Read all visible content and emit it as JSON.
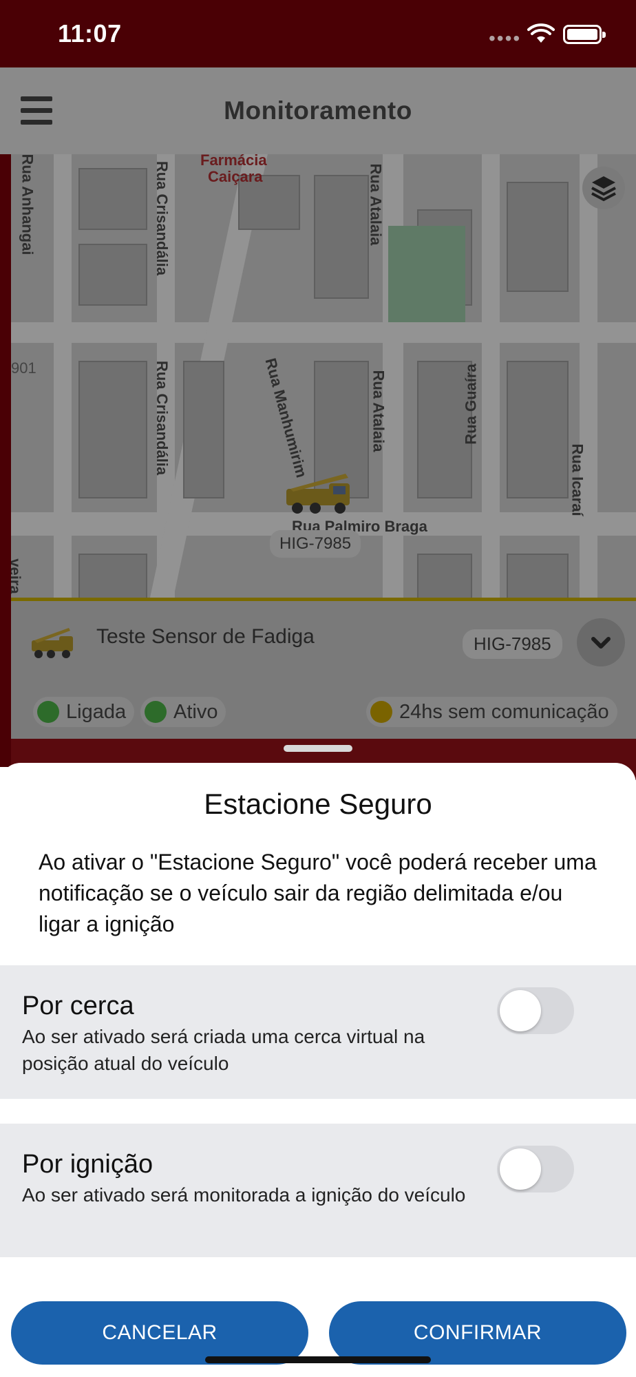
{
  "status": {
    "time": "11:07"
  },
  "header": {
    "title": "Monitoramento"
  },
  "map": {
    "labels": {
      "pharmacy_line1": "Farmácia",
      "pharmacy_line2": "Caiçara",
      "rua_anhangai": "Rua Anhangai",
      "rua_crisandalia_top": "Rua Crisandália",
      "rua_crisandalia_bottom": "Rua Crisandália",
      "rua_atalaia_top": "Rua Atalaia",
      "rua_atalaia_bottom": "Rua Atalaia",
      "rua_manhumirim": "Rua Manhumirim",
      "rua_guaira": "Rua Guaíra",
      "rua_icarai": "Rua Icaraí",
      "rua_palmiro_braga": "Rua Palmiro Braga",
      "house_number": "901",
      "left_edge": "veira"
    },
    "marker_plate": "HIG-7985"
  },
  "vehicle": {
    "name": "Teste Sensor de Fadiga",
    "plate": "HIG-7985",
    "chips": {
      "ignition": "Ligada",
      "status": "Ativo",
      "communication": "24hs sem comunicação"
    }
  },
  "sheet": {
    "title": "Estacione Seguro",
    "description": "Ao ativar o \"Estacione Seguro\" você poderá receber uma notificação se o veículo sair da região delimitada e/ou ligar a ignição",
    "options": [
      {
        "title": "Por cerca",
        "description": "Ao ser ativado será criada uma cerca virtual na posição atual do veículo",
        "enabled": false
      },
      {
        "title": "Por ignição",
        "description": "Ao ser ativado será monitorada a ignição do veículo",
        "enabled": false
      }
    ],
    "cancel_label": "CANCELAR",
    "confirm_label": "CONFIRMAR"
  },
  "colors": {
    "primary_button": "#1b62ad",
    "status_bar": "#4a0005",
    "toggle_off": "#d7d8dc"
  }
}
